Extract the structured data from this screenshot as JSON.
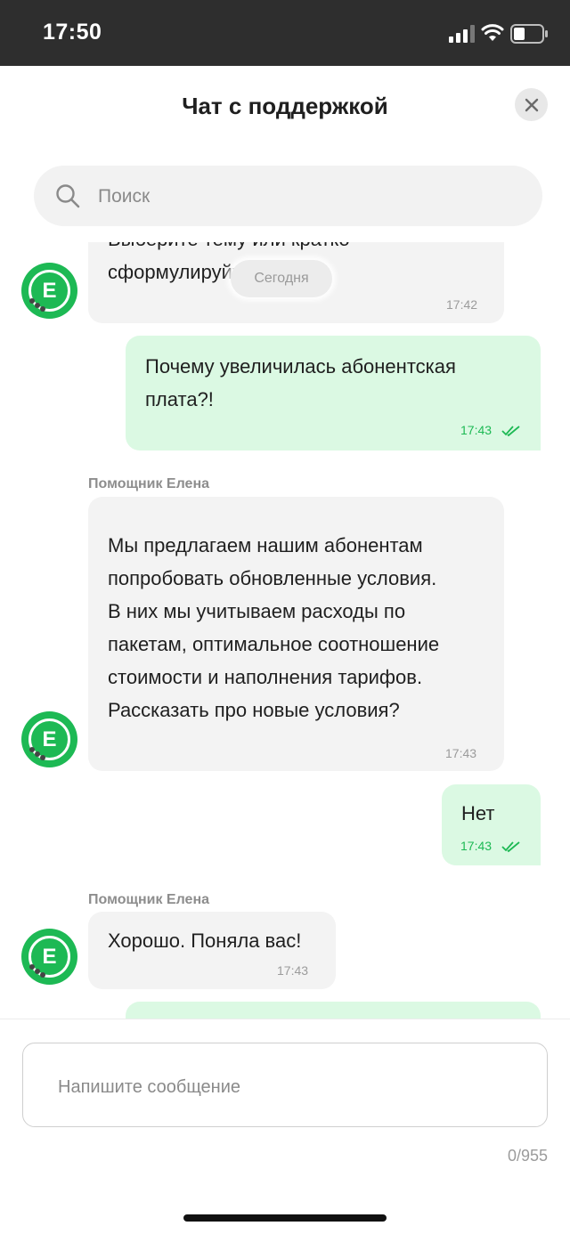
{
  "status_bar": {
    "time": "17:50"
  },
  "header": {
    "title": "Чат с поддержкой"
  },
  "search": {
    "placeholder": "Поиск"
  },
  "date_chip": "Сегодня",
  "messages": [
    {
      "direction": "incoming",
      "lines": [
        "Выберите тему или кратко",
        "сформулируйте вопрос."
      ],
      "time": "17:42"
    },
    {
      "direction": "outgoing",
      "lines": [
        "Почему увеличилась абонентская",
        "плата?!"
      ],
      "time": "17:43",
      "read": true
    },
    {
      "direction": "incoming",
      "sender": "Помощник Елена",
      "lines": [
        "Мы предлагаем нашим абонентам",
        "попробовать обновленные условия.",
        "В них мы учитываем расходы по",
        "пакетам, оптимальное соотношение",
        "стоимости и наполнения тарифов.",
        "Рассказать про новые условия?"
      ],
      "time": "17:43"
    },
    {
      "direction": "outgoing",
      "lines": [
        "Нет"
      ],
      "time": "17:43",
      "read": true
    },
    {
      "direction": "incoming",
      "sender": "Помощник Елена",
      "lines": [
        "Хорошо. Поняла вас!"
      ],
      "time": "17:43"
    }
  ],
  "avatar_letter": "Е",
  "composer": {
    "placeholder": "Напишите сообщение",
    "counter": "0/955"
  },
  "colors": {
    "accent": "#1db954",
    "outgoing_bubble": "#dbf9e3",
    "incoming_bubble": "#f3f3f3",
    "status_bar": "#2e2e2e"
  }
}
